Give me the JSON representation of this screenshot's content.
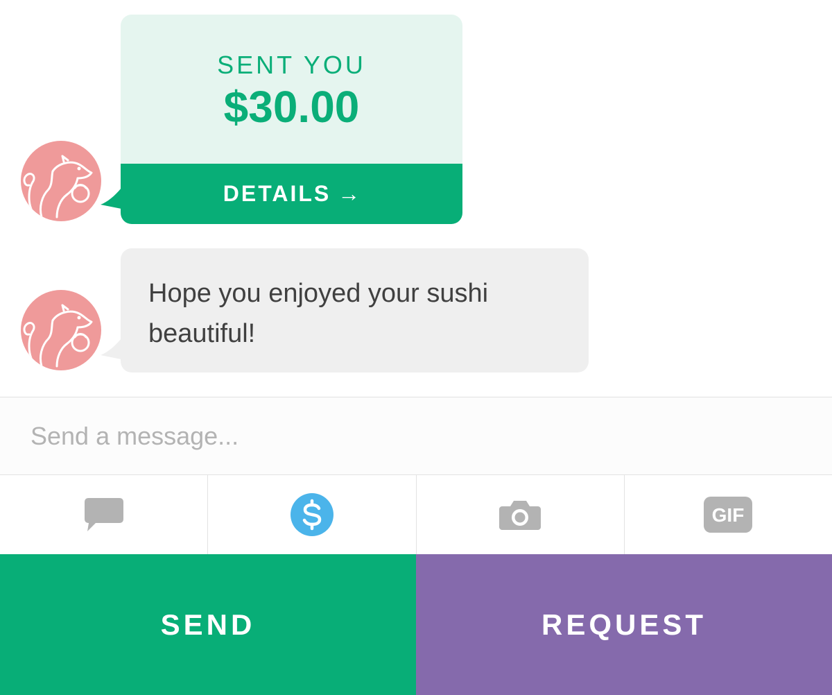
{
  "colors": {
    "green": "#08ae77",
    "purple": "#856aac",
    "avatar": "#ef9a9a",
    "dollar_icon": "#4bb4ea"
  },
  "payment": {
    "label": "SENT YOU",
    "amount": "$30.00",
    "details_label": "DETAILS",
    "details_arrow": "→"
  },
  "message": {
    "text": "Hope you enjoyed your sushi beautiful!"
  },
  "composer": {
    "placeholder": "Send a message..."
  },
  "toolbar": {
    "items": [
      {
        "icon": "chat-bubble-icon",
        "active": false
      },
      {
        "icon": "dollar-icon",
        "active": true
      },
      {
        "icon": "camera-icon",
        "active": false
      },
      {
        "icon": "gif-icon",
        "label": "GIF",
        "active": false
      }
    ]
  },
  "actions": {
    "send_label": "SEND",
    "request_label": "REQUEST"
  }
}
